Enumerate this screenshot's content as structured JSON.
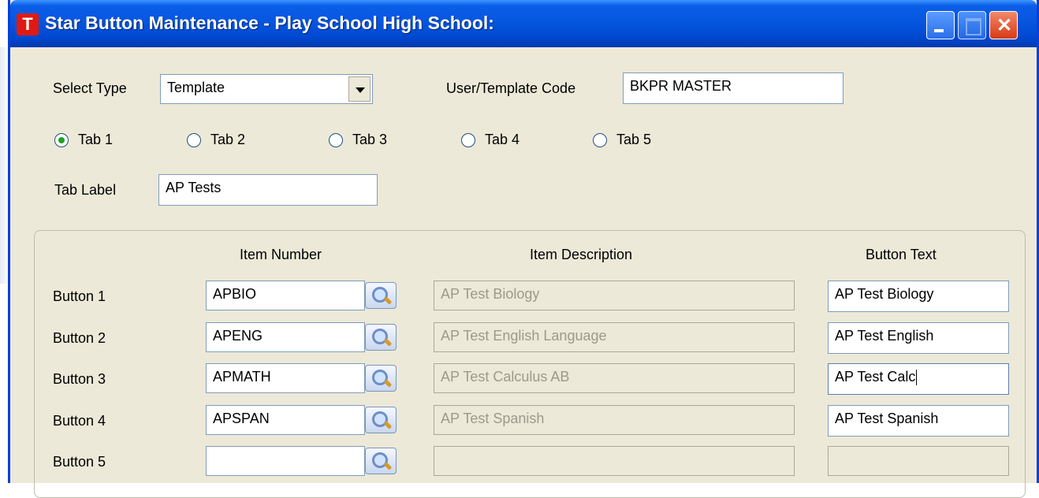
{
  "window": {
    "title": "Star Button Maintenance - Play School High School:",
    "app_icon_letter": "T"
  },
  "form": {
    "select_type_label": "Select Type",
    "select_type_value": "Template",
    "code_label": "User/Template Code",
    "code_value": "BKPR MASTER",
    "tabs": [
      {
        "label": "Tab 1",
        "checked": true
      },
      {
        "label": "Tab 2",
        "checked": false
      },
      {
        "label": "Tab 3",
        "checked": false
      },
      {
        "label": "Tab 4",
        "checked": false
      },
      {
        "label": "Tab 5",
        "checked": false
      }
    ],
    "tab_label_label": "Tab Label",
    "tab_label_value": "AP Tests"
  },
  "grid": {
    "headers": {
      "item_number": "Item Number",
      "item_description": "Item Description",
      "button_text": "Button Text"
    },
    "rows": [
      {
        "label": "Button 1",
        "item_number": "APBIO",
        "description": "AP Test Biology",
        "button_text": "AP Test Biology"
      },
      {
        "label": "Button 2",
        "item_number": "APENG",
        "description": "AP Test English Language",
        "button_text": "AP Test English"
      },
      {
        "label": "Button 3",
        "item_number": "APMATH",
        "description": "AP Test Calculus AB",
        "button_text": "AP Test Calc"
      },
      {
        "label": "Button 4",
        "item_number": "APSPAN",
        "description": "AP Test Spanish",
        "button_text": "AP Test Spanish"
      },
      {
        "label": "Button 5",
        "item_number": "",
        "description": "",
        "button_text": ""
      }
    ]
  },
  "colors": {
    "titlebar": "#0656e0",
    "window_bg": "#ece9d8",
    "radio_dot": "#21a121",
    "close_button": "#d83a14"
  }
}
